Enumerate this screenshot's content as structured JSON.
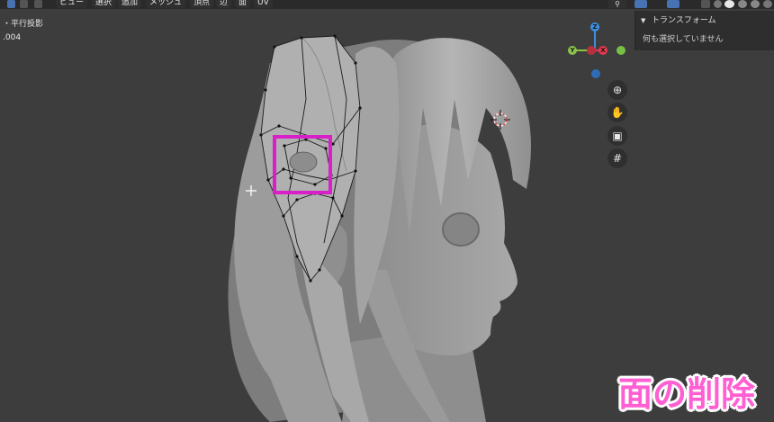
{
  "menu": [
    "ビュー",
    "選択",
    "追加",
    "メッシュ",
    "頂点",
    "辺",
    "面",
    "UV"
  ],
  "viewport_info": {
    "line1": "・平行投影",
    "line2": ".004"
  },
  "n_panel": {
    "section_title": "トランスフォーム",
    "message": "何も選択していません"
  },
  "gizmo": {
    "z_label": "Z",
    "y_label": "Y",
    "x_label": "X",
    "colors": {
      "x": "#e8384f",
      "y": "#8bc34a",
      "z": "#3d8fe0"
    }
  },
  "nav_icons": [
    "zoom-icon",
    "hand-pan-icon",
    "camera-icon",
    "grid-icon"
  ],
  "caption": "面の削除",
  "highlight_color": "#d81fc8"
}
